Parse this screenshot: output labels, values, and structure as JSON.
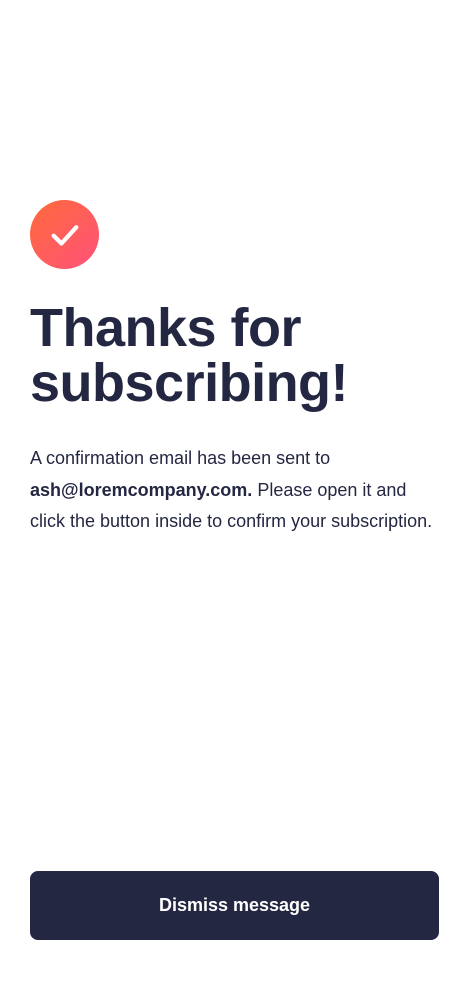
{
  "icon": {
    "name": "checkmark-icon",
    "gradient_start": "#ff6a3a",
    "gradient_end": "#ff527b"
  },
  "title_line1": "Thanks for",
  "title_line2": "subscribing!",
  "message": {
    "intro": "A confirmation email has been sent to",
    "email": "ash@loremcompany.com.",
    "rest": "Please open it and click the button inside to confirm your subscription."
  },
  "dismiss_button_label": "Dismiss message",
  "colors": {
    "text": "#242742",
    "button_bg": "#242742",
    "button_text": "#ffffff",
    "background": "#ffffff"
  }
}
